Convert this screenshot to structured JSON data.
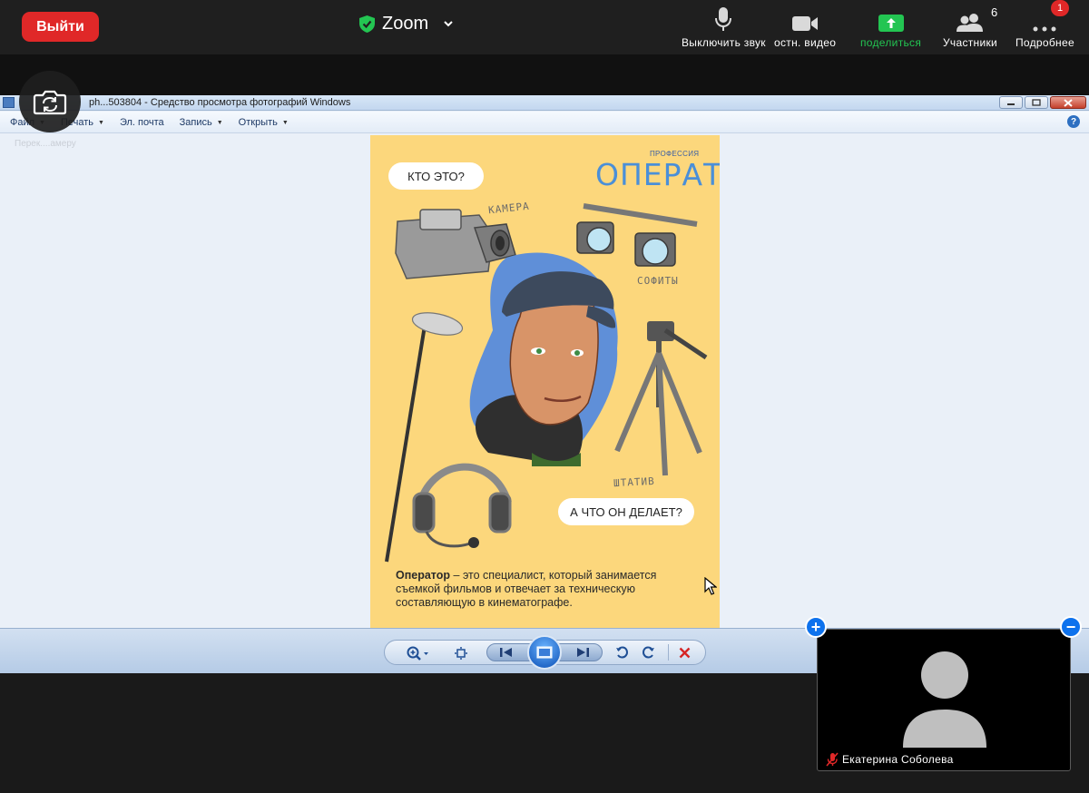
{
  "zoom": {
    "leave_label": "Выйти",
    "title": "Zoom",
    "controls": {
      "mute": "Выключить звук",
      "video": "остн. видео",
      "share": "поделиться",
      "participants": "Участники",
      "more": "Подробнее"
    },
    "participants_count": "6",
    "more_badge": "1",
    "accent": "#0e72ed",
    "leave_color": "#e02828",
    "share_color": "#23c552"
  },
  "camera_switch": {
    "label": "Перек....амеру",
    "icon": "camera-switch-icon"
  },
  "viewer": {
    "title": "ph...503804 - Средство просмотра фотографий Windows",
    "menu": [
      "Файл",
      "Печать",
      "Эл. почта",
      "Запись",
      "Открыть"
    ],
    "help": "?",
    "window_buttons": [
      "minimize-icon",
      "maximize-icon",
      "close-icon"
    ]
  },
  "poster": {
    "bubble_who": "КТО ЭТО?",
    "label_small": "ПРОФЕССИЯ",
    "label_big": "ОПЕРАТОР",
    "camera": "КАМЕРА",
    "lights": "СОФИТЫ",
    "tripod": "ШТАТИВ",
    "bubble_what": "А ЧТО ОН ДЕЛАЕТ?",
    "desc_bold": "Оператор",
    "desc_rest": " – это специалист, который занимается съемкой фильмов и отвечает за техническую составляющую в кинематографе."
  },
  "toolbar": {
    "buttons": [
      "zoom-icon",
      "fit-icon",
      "prev-icon",
      "slideshow-icon",
      "next-icon",
      "rotate-left-icon",
      "rotate-right-icon",
      "delete-icon"
    ]
  },
  "participant": {
    "name": "Екатерина Соболева",
    "muted": true
  }
}
